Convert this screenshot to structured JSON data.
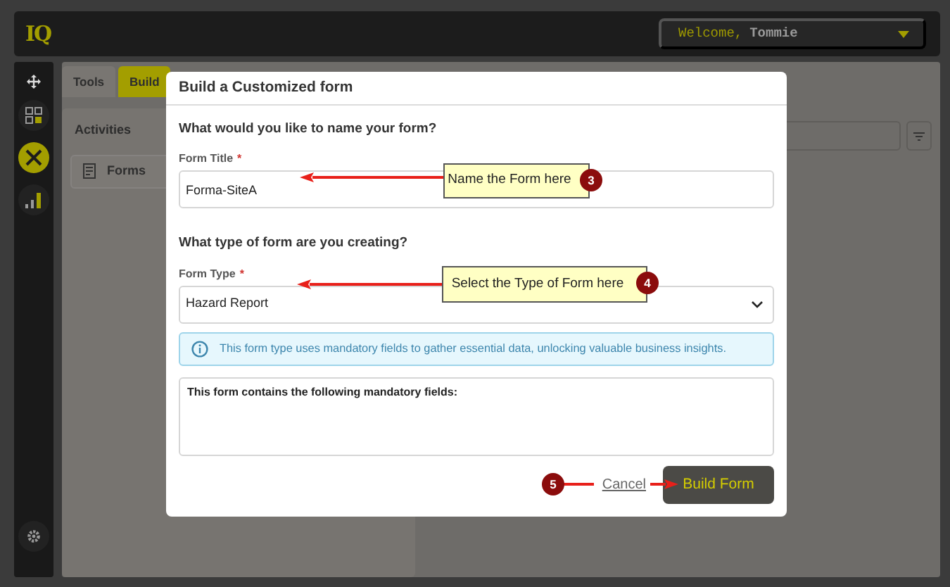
{
  "header": {
    "logo": "IQ",
    "welcome": "Welcome,",
    "user": "Tommie"
  },
  "sidebar": {
    "items": [
      {
        "kind": "apps",
        "selected": false
      },
      {
        "kind": "tools",
        "selected": true
      },
      {
        "kind": "reports",
        "selected": false
      }
    ],
    "footer": {
      "kind": "settings"
    }
  },
  "tabs": [
    {
      "label": "Tools",
      "selected": false
    },
    {
      "label": "Build",
      "selected": true
    }
  ],
  "activities": {
    "title": "Activities",
    "items": [
      {
        "label": "Forms"
      }
    ]
  },
  "modal": {
    "title": "Build a Customized form",
    "sections": [
      {
        "heading": "What would you like to name your form?",
        "field": {
          "kind": "text",
          "label": "Form Title",
          "required_mark": "*",
          "value": "Forma-SiteA"
        }
      },
      {
        "heading": "What type of form are you creating?",
        "field": {
          "kind": "select",
          "label": "Form Type",
          "required_mark": "*",
          "value": "Hazard Report"
        }
      }
    ],
    "info": "This form type uses mandatory fields to gather essential data, unlocking valuable business insights.",
    "mandatory_box": {
      "title": "This form contains the following mandatory fields:"
    },
    "buttons": [
      {
        "kind": "link",
        "label": "Cancel"
      },
      {
        "kind": "primary",
        "label": "Build Form"
      }
    ]
  },
  "callouts": [
    {
      "number": "3",
      "text": "Name the Form here"
    },
    {
      "number": "4",
      "text": "Select the Type of Form here"
    },
    {
      "number": "5"
    }
  ]
}
